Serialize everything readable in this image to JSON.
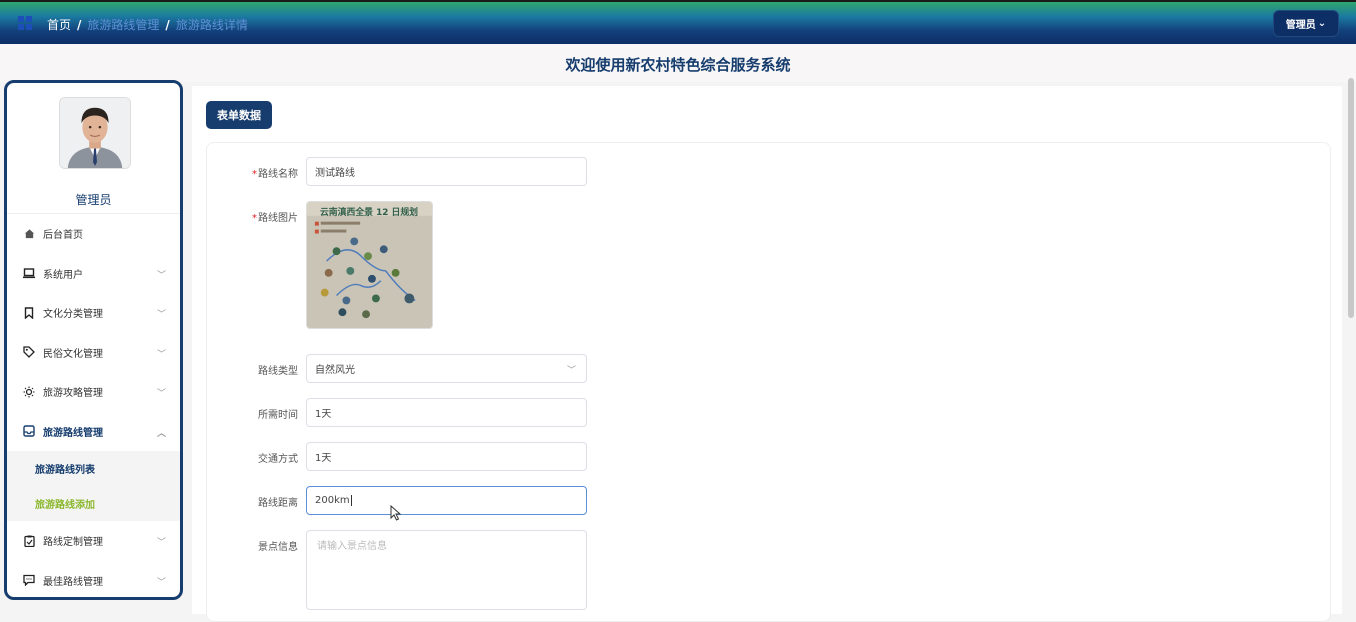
{
  "header": {
    "breadcrumb": [
      "首页",
      "旅游路线管理",
      "旅游路线详情"
    ],
    "admin_button": "管理员",
    "system_title": "欢迎使用新农村特色综合服务系统"
  },
  "sidebar": {
    "user_name": "管理员",
    "items": [
      {
        "label": "后台首页",
        "icon": "home-icon"
      },
      {
        "label": "系统用户",
        "icon": "laptop-icon"
      },
      {
        "label": "文化分类管理",
        "icon": "bookmark-icon"
      },
      {
        "label": "民俗文化管理",
        "icon": "tag-icon"
      },
      {
        "label": "旅游攻略管理",
        "icon": "sun-icon"
      },
      {
        "label": "旅游路线管理",
        "icon": "inbox-icon"
      },
      {
        "label": "路线定制管理",
        "icon": "clipboard-icon"
      },
      {
        "label": "最佳路线管理",
        "icon": "message-icon"
      }
    ],
    "submenu": [
      "旅游路线列表",
      "旅游路线添加"
    ]
  },
  "content": {
    "tab_label": "表单数据",
    "form": {
      "route_name_label": "路线名称",
      "route_name_value": "测试路线",
      "route_image_label": "路线图片",
      "route_image_title": "云南滇西全景 12 日规划",
      "route_type_label": "路线类型",
      "route_type_value": "自然风光",
      "time_label": "所需时间",
      "time_value": "1天",
      "transport_label": "交通方式",
      "transport_value": "1天",
      "distance_label": "路线距离",
      "distance_value": "200km",
      "scenic_label": "景点信息",
      "scenic_placeholder": "请输入景点信息"
    }
  },
  "colors": {
    "primary": "#163d6e",
    "accent_green": "#8cb82f",
    "required": "#e02020"
  }
}
